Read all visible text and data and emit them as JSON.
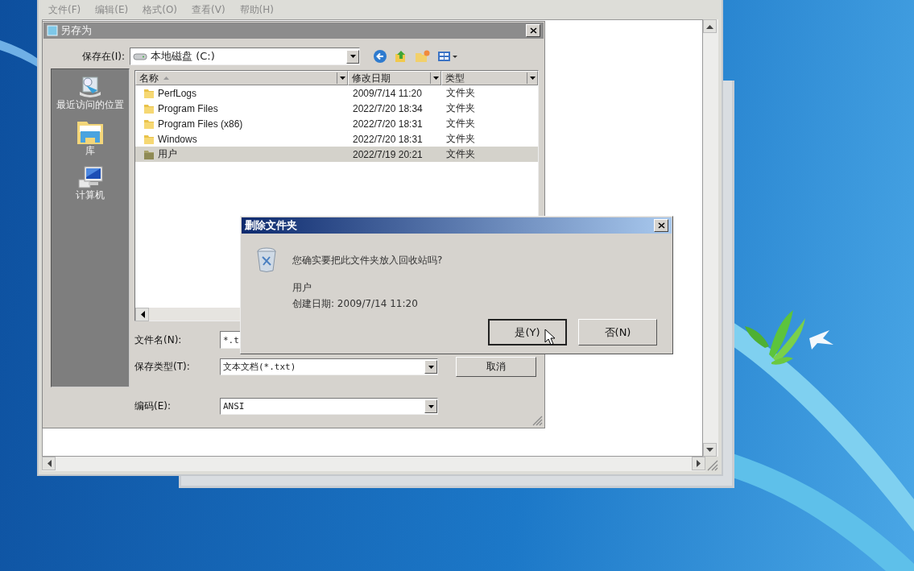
{
  "notepad": {
    "menu": [
      "文件(F)",
      "编辑(E)",
      "格式(O)",
      "查看(V)",
      "帮助(H)"
    ]
  },
  "save_dialog": {
    "title": "另存为",
    "save_in_label": "保存在(I):",
    "location": "本地磁盘 (C:)",
    "places": [
      {
        "kind": "recent",
        "label": "最近访问的位置"
      },
      {
        "kind": "library",
        "label": "库"
      },
      {
        "kind": "computer",
        "label": "计算机"
      }
    ],
    "columns": [
      "名称",
      "修改日期",
      "类型"
    ],
    "rows": [
      {
        "name": "PerfLogs",
        "modified": "2009/7/14 11:20",
        "type": "文件夹",
        "selected": false
      },
      {
        "name": "Program Files",
        "modified": "2022/7/20 18:34",
        "type": "文件夹",
        "selected": false
      },
      {
        "name": "Program Files (x86)",
        "modified": "2022/7/20 18:31",
        "type": "文件夹",
        "selected": false
      },
      {
        "name": "Windows",
        "modified": "2022/7/20 18:31",
        "type": "文件夹",
        "selected": false
      },
      {
        "name": "用户",
        "modified": "2022/7/19 20:21",
        "type": "文件夹",
        "selected": true
      }
    ],
    "filename_label": "文件名(N):",
    "filename_value": "*.t",
    "type_label": "保存类型(T):",
    "type_value": "文本文档(*.txt)",
    "encoding_label": "编码(E):",
    "encoding_value": "ANSI",
    "cancel_button": "取消"
  },
  "delete_dialog": {
    "title": "删除文件夹",
    "question": "您确实要把此文件夹放入回收站吗?",
    "item_name": "用户",
    "created": "创建日期: 2009/7/14 11:20",
    "buttons": [
      {
        "label": "是(Y)",
        "focused": true
      },
      {
        "label": "否(N)",
        "focused": false
      }
    ]
  }
}
